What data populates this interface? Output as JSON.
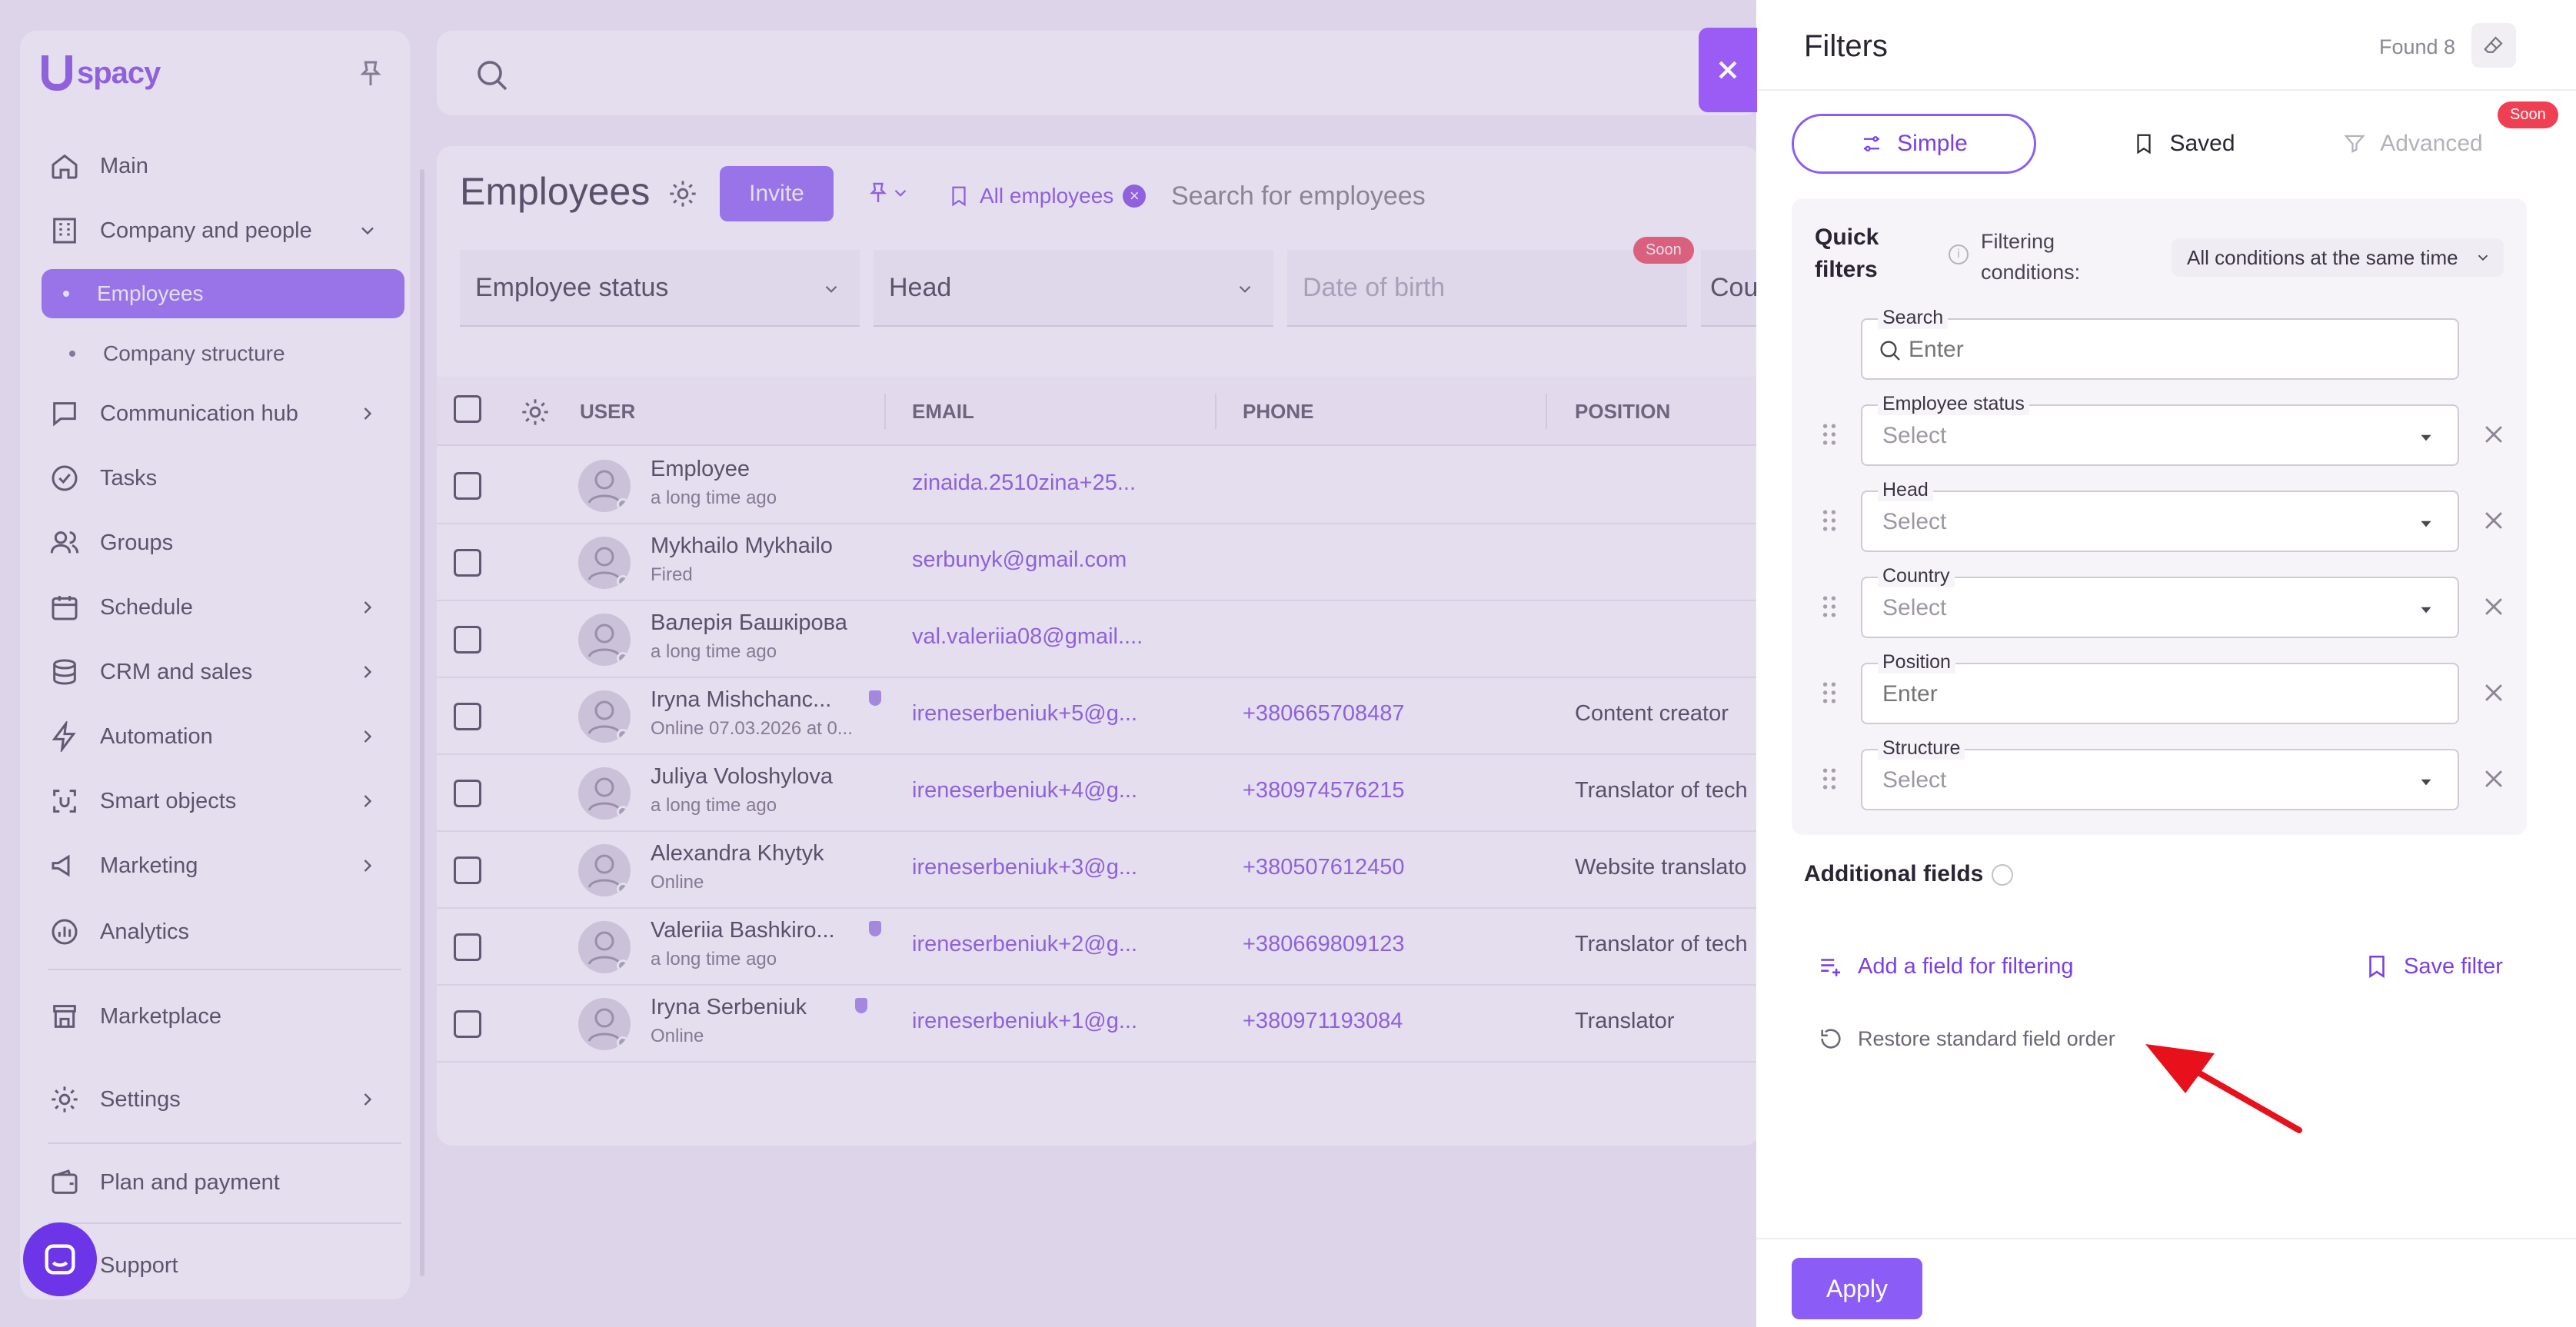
{
  "sidebar": {
    "brand": "spacy",
    "items": [
      {
        "label": "Main",
        "icon": "home-icon"
      },
      {
        "label": "Company and people",
        "icon": "building-icon"
      },
      {
        "label": "Employees"
      },
      {
        "label": "Company structure"
      },
      {
        "label": "Communication hub",
        "icon": "chat-icon"
      },
      {
        "label": "Tasks",
        "icon": "check-circle-icon"
      },
      {
        "label": "Groups",
        "icon": "users-icon"
      },
      {
        "label": "Schedule",
        "icon": "calendar-icon"
      },
      {
        "label": "CRM and sales",
        "icon": "database-icon"
      },
      {
        "label": "Automation",
        "icon": "lightning-icon"
      },
      {
        "label": "Smart objects",
        "icon": "scan-icon"
      },
      {
        "label": "Marketing",
        "icon": "megaphone-icon"
      },
      {
        "label": "Analytics",
        "icon": "chart-icon"
      },
      {
        "label": "Marketplace",
        "icon": "store-icon"
      },
      {
        "label": "Settings",
        "icon": "gear-icon"
      },
      {
        "label": "Plan and payment",
        "icon": "wallet-icon"
      },
      {
        "label": "Support",
        "icon": "support-icon"
      }
    ]
  },
  "employees": {
    "title": "Employees",
    "invite_label": "Invite",
    "chip_label": "All employees",
    "search_placeholder": "Search for employees",
    "filters": [
      "Employee status",
      "Head",
      "Date of birth",
      "Cou"
    ],
    "soon_label": "Soon",
    "columns": [
      "USER",
      "EMAIL",
      "PHONE",
      "POSITION"
    ],
    "rows": [
      {
        "name": "Employee",
        "sub": "a long time ago",
        "email": "zinaida.2510zina+25...",
        "phone": "",
        "position": ""
      },
      {
        "name": "Mykhailo Mykhailo",
        "sub": "Fired",
        "email": "serbunyk@gmail.com",
        "phone": "",
        "position": ""
      },
      {
        "name": "Валерія Башкірова",
        "sub": "a long time ago",
        "email": "val.valeriia08@gmail....",
        "phone": "",
        "position": ""
      },
      {
        "name": "Iryna Mishchanc...",
        "sub": "Online 07.03.2026 at 0...",
        "email": "ireneserbeniuk+5@g...",
        "phone": "+380665708487",
        "position": "Content creator"
      },
      {
        "name": "Juliya Voloshylova",
        "sub": "a long time ago",
        "email": "ireneserbeniuk+4@g...",
        "phone": "+380974576215",
        "position": "Translator of tech"
      },
      {
        "name": "Alexandra Khytyk",
        "sub": "Online",
        "email": "ireneserbeniuk+3@g...",
        "phone": "+380507612450",
        "position": "Website translato"
      },
      {
        "name": "Valeriia Bashkiro...",
        "sub": "a long time ago",
        "email": "ireneserbeniuk+2@g...",
        "phone": "+380669809123",
        "position": "Translator of tech"
      },
      {
        "name": "Iryna Serbeniuk",
        "sub": "Online",
        "email": "ireneserbeniuk+1@g...",
        "phone": "+380971193084",
        "position": "Translator"
      }
    ]
  },
  "drawer": {
    "title": "Filters",
    "found": "Found 8",
    "tabs": {
      "simple": "Simple",
      "saved": "Saved",
      "advanced": "Advanced",
      "soon": "Soon"
    },
    "quick_filters_line1": "Quick",
    "quick_filters_line2": "filters",
    "conditions_line1": "Filtering",
    "conditions_line2": "conditions:",
    "conditions_value": "All conditions at the same time",
    "fields": [
      {
        "label": "Search",
        "placeholder": "Enter"
      },
      {
        "label": "Employee status",
        "placeholder": "Select"
      },
      {
        "label": "Head",
        "placeholder": "Select"
      },
      {
        "label": "Country",
        "placeholder": "Select"
      },
      {
        "label": "Position",
        "placeholder": "Enter"
      },
      {
        "label": "Structure",
        "placeholder": "Select"
      }
    ],
    "additional_fields": "Additional fields",
    "add_field": "Add a field for filtering",
    "save_filter": "Save filter",
    "restore": "Restore standard field order",
    "apply": "Apply"
  },
  "colors": {
    "accent": "#8b5cf6",
    "accent_text": "#7b3fe4",
    "soon_badge": "#ef3f52",
    "arrow": "#e8101a"
  }
}
